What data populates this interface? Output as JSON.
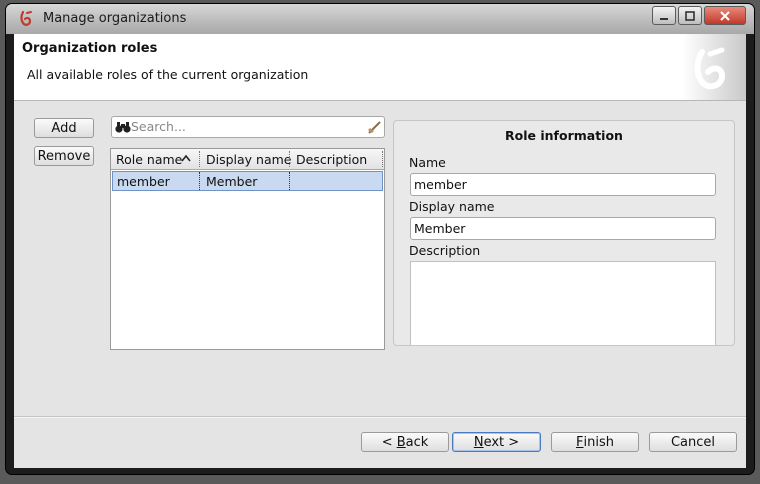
{
  "window": {
    "title": "Manage organizations",
    "controls": [
      "minimize-icon",
      "maximize-icon",
      "close-icon"
    ]
  },
  "header": {
    "title": "Organization roles",
    "subtitle": "All available roles of the current organization"
  },
  "list_actions": {
    "add_label": "Add",
    "remove_label": "Remove"
  },
  "search": {
    "placeholder": "Search..."
  },
  "roles_table": {
    "columns": [
      "Role name",
      "Display name",
      "Description"
    ],
    "sort_column": "Role name",
    "sort_direction": "ascending",
    "rows": [
      {
        "role_name": "member",
        "display_name": "Member",
        "description": ""
      }
    ]
  },
  "role_info": {
    "title": "Role information",
    "name_label": "Name",
    "name_value": "member",
    "display_name_label": "Display name",
    "display_name_value": "Member",
    "description_label": "Description",
    "description_value": ""
  },
  "wizard_buttons": {
    "back_label": "Back",
    "back_mnemonic": "B",
    "next_label": "Next",
    "next_mnemonic": "N",
    "finish_label": "Finish",
    "finish_mnemonic": "F",
    "cancel_label": "Cancel"
  },
  "colors": {
    "accent": "#c0392b",
    "selection": "#c9d9f0"
  }
}
